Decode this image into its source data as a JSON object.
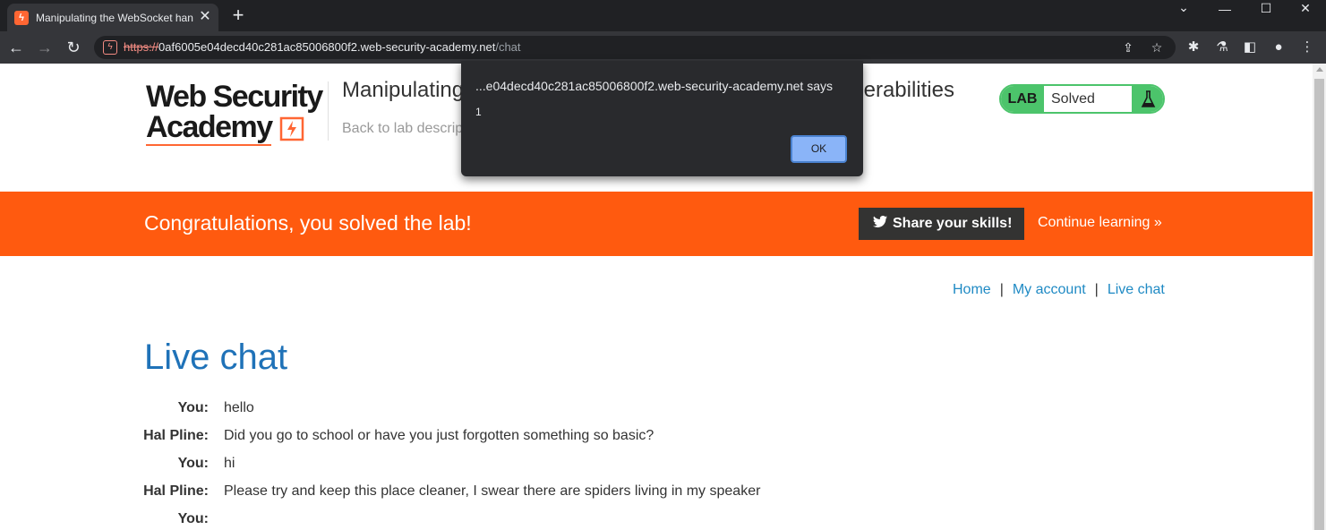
{
  "browser": {
    "tab_title": "Manipulating the WebSocket handshake to exploit vulnerabilities",
    "tab_close": "✕",
    "new_tab": "+",
    "url_scheme": "https://",
    "url_host": "0af6005e04decd40c281ac85006800f2.web-security-academy.net",
    "url_path": "/chat"
  },
  "header": {
    "logo_line1": "Web Security",
    "logo_line2": "Academy",
    "lab_title": "Manipulating the WebSocket handshake to exploit vulnerabilities",
    "back_link": "Back to lab description",
    "lab_badge": {
      "label": "LAB",
      "status": "Solved"
    }
  },
  "banner": {
    "message": "Congratulations, you solved the lab!",
    "share_label": "Share your skills!",
    "continue_label": "Continue learning"
  },
  "nav": {
    "home": "Home",
    "separator": "|",
    "my_account": "My account",
    "live_chat": "Live chat"
  },
  "main": {
    "heading": "Live chat",
    "messages": [
      {
        "name": "You:",
        "text": "hello"
      },
      {
        "name": "Hal Pline:",
        "text": "Did you go to school or have you just forgotten something so basic?"
      },
      {
        "name": "You:",
        "text": "hi"
      },
      {
        "name": "Hal Pline:",
        "text": "Please try and keep this place cleaner, I swear there are spiders living in my speaker"
      },
      {
        "name": "You:",
        "text": ""
      }
    ]
  },
  "dialog": {
    "title": "...e04decd40c281ac85006800f2.web-security-academy.net says",
    "message": "1",
    "ok_label": "OK"
  },
  "colors": {
    "banner": "#ff5a0f",
    "lab_solved": "#4cc46b",
    "link": "#1f8ac4",
    "heading": "#1f72b8"
  }
}
